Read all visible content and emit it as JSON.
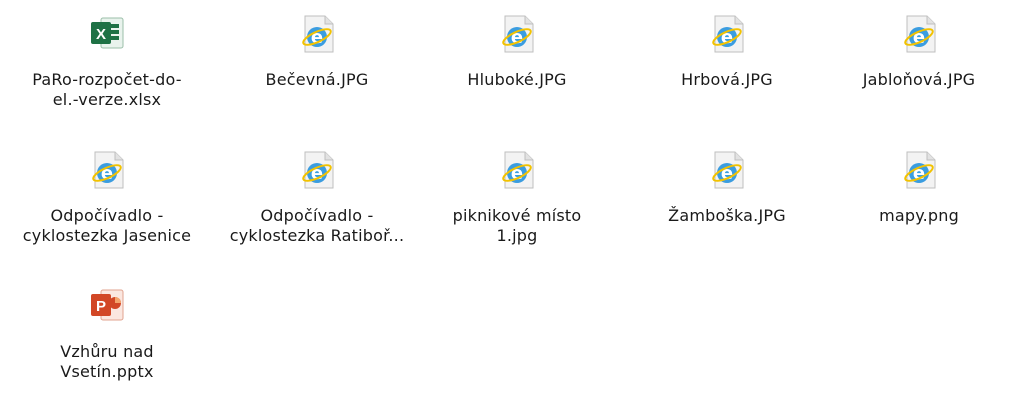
{
  "files": [
    {
      "label": "PaRo-rozpočet-do-\nel.-verze.xlsx",
      "icon": "excel-icon"
    },
    {
      "label": "Bečevná.JPG",
      "icon": "ie-icon"
    },
    {
      "label": "Hluboké.JPG",
      "icon": "ie-icon"
    },
    {
      "label": "Hrbová.JPG",
      "icon": "ie-icon"
    },
    {
      "label": "Jabloňová.JPG",
      "icon": "ie-icon"
    },
    {
      "label": "Odpočívadlo -\ncyklostezka Jasenice",
      "icon": "ie-icon"
    },
    {
      "label": "Odpočívadlo -\ncyklostezka Ratiboř...",
      "icon": "ie-icon"
    },
    {
      "label": "piknikové místo\n1.jpg",
      "icon": "ie-icon"
    },
    {
      "label": "Žamboška.JPG",
      "icon": "ie-icon"
    },
    {
      "label": "mapy.png",
      "icon": "ie-icon"
    },
    {
      "label": "Vzhůru nad\nVsetín.pptx",
      "icon": "powerpoint-icon"
    }
  ],
  "colors": {
    "excel_green": "#1E7145",
    "ie_blue": "#1E90FF",
    "ppt_red": "#D24726"
  }
}
